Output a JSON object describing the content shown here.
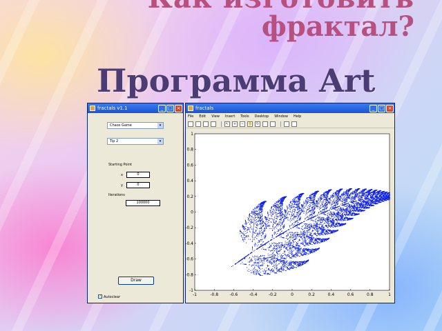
{
  "slide": {
    "title_line1": "Как изготовить",
    "title_line2": "фрактал?",
    "subtitle": "Программа Art"
  },
  "dialog": {
    "title": "fractals v1.1",
    "dropdown1": "Chaos Game",
    "dropdown2": "Tip 2",
    "starting_point_label": "Starting Point",
    "x_label": "x",
    "x_value": "0",
    "y_label": "y",
    "y_value": "0",
    "iterations_label": "Iterations",
    "iterations_value": "100000",
    "draw_button": "Draw",
    "checkbox_label": "Autoclear",
    "checkbox_checked": true
  },
  "figure": {
    "title": "fractals",
    "menu": [
      "File",
      "Edit",
      "View",
      "Insert",
      "Tools",
      "Desktop",
      "Window",
      "Help"
    ],
    "toolbar_icons": [
      "new-file-icon",
      "open-icon",
      "save-icon",
      "print-icon",
      "arrow-icon",
      "zoom-in-icon",
      "zoom-out-icon",
      "pan-icon",
      "rotate-icon",
      "datacursor-icon",
      "colorbar-icon",
      "legend-icon",
      "hide-icon",
      "show-icon"
    ],
    "point_color": "#0a1ee6"
  },
  "chart_data": {
    "type": "scatter",
    "title": "",
    "xlabel": "",
    "ylabel": "",
    "xlim": [
      -1,
      1
    ],
    "ylim": [
      -1,
      1
    ],
    "x_ticks": [
      "-1",
      "-0.8",
      "-0.6",
      "-0.4",
      "-0.2",
      "0",
      "0.2",
      "0.4",
      "0.6",
      "0.8",
      "1"
    ],
    "y_ticks": [
      "1",
      "0.8",
      "0.6",
      "0.4",
      "0.2",
      "0",
      "-0.2",
      "-0.4",
      "-0.6",
      "-0.8",
      "-1"
    ],
    "series": [
      {
        "values": "fern-shaped point cloud (chaos game attractor)"
      }
    ],
    "grid": false
  }
}
